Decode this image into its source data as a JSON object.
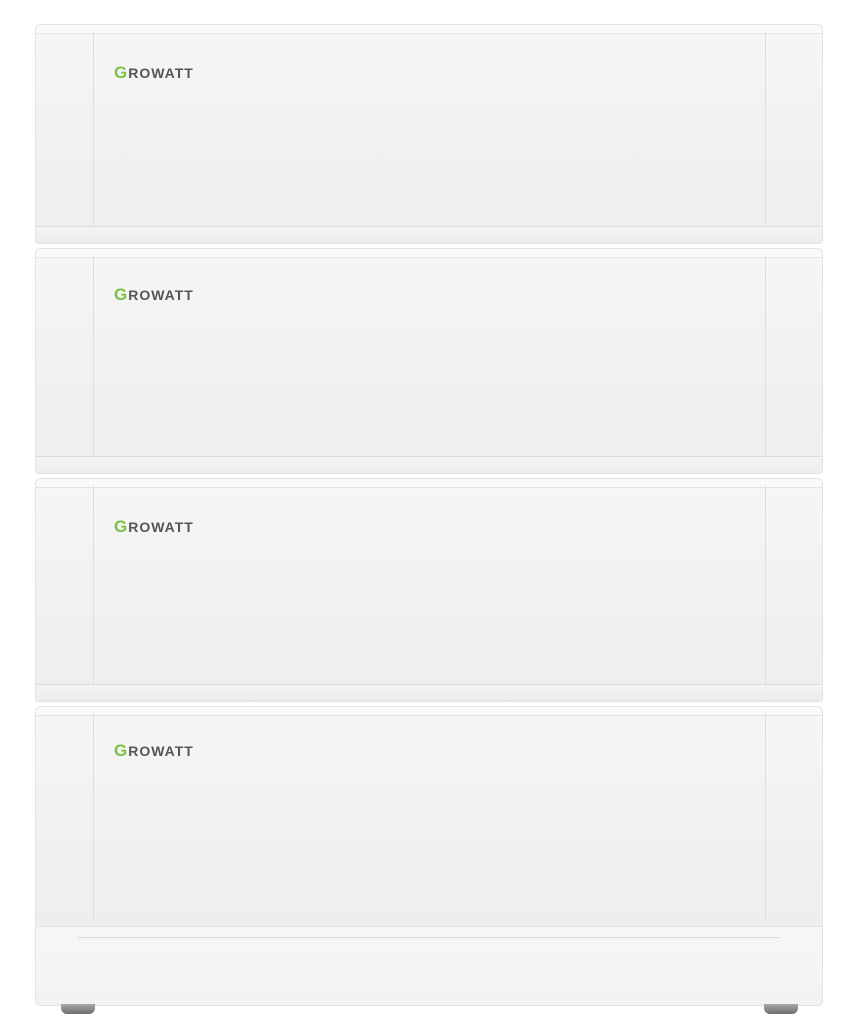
{
  "product": {
    "brand_logo": "GROWATT",
    "brand_colors": {
      "accent": "#7dc243",
      "wordmark": "#555555",
      "body": "#f2f2f2"
    },
    "module_count": 4,
    "modules": [
      {
        "logo": "GROWATT"
      },
      {
        "logo": "GROWATT"
      },
      {
        "logo": "GROWATT"
      },
      {
        "logo": "GROWATT"
      }
    ]
  }
}
